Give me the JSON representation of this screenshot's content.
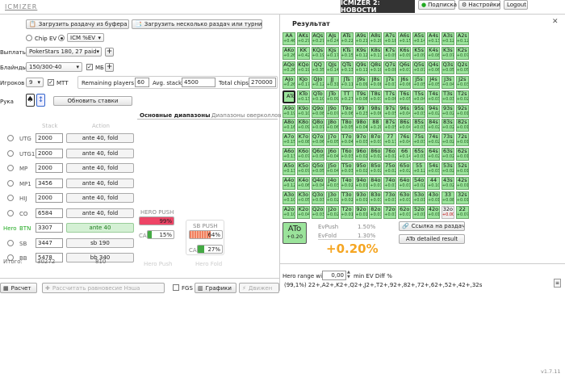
{
  "app": {
    "title": "ICMIZER",
    "version": "v1.7.11"
  },
  "banner": {
    "text": "ICMIZER 2: НОВОСТИ"
  },
  "top_buttons": {
    "subscribe": "Подписка",
    "settings": "Настройки",
    "logout": "Logout"
  },
  "toolbar": {
    "load_from_buffer": "Загрузить раздачу из буфера",
    "load_multiple": "Загрузить несколько раздач или турнир"
  },
  "model": {
    "chip_ev": "Chip EV",
    "icm_select": "ICM %EV"
  },
  "payouts": {
    "label": "Выплаты",
    "value": "PokerStars 180, 27 paid"
  },
  "blinds": {
    "label": "Блайнды",
    "value": "150/300-40",
    "mb_label": "МБ",
    "mb_checked": "✓"
  },
  "players": {
    "label": "Игроков",
    "value": "9",
    "mtt_label": "MTT",
    "mtt_checked": "✓",
    "remaining_label": "Remaining players",
    "remaining_value": "60",
    "avg_stack_label": "Avg. stack",
    "avg_stack_value": "4500",
    "total_chips_label": "Total chips",
    "total_chips_value": "270000"
  },
  "hand": {
    "label": "Рука",
    "update_button": "Обновить ставки"
  },
  "ranges_tabs": {
    "main": "Основные диапазоны",
    "overcall": "Диапазоны оверколлов"
  },
  "columns": {
    "stack": "Stack",
    "action": "Action"
  },
  "positions": [
    {
      "name": "UTG",
      "stack": "2000",
      "action": "ante 40, fold"
    },
    {
      "name": "UTG1",
      "stack": "2000",
      "action": "ante 40, fold"
    },
    {
      "name": "MP",
      "stack": "2000",
      "action": "ante 40, fold"
    },
    {
      "name": "MP1",
      "stack": "3456",
      "action": "ante 40, fold"
    },
    {
      "name": "HIJ",
      "stack": "2000",
      "action": "ante 40, fold"
    },
    {
      "name": "CO",
      "stack": "6584",
      "action": "ante 40, fold"
    },
    {
      "name": "BTN",
      "hero": "Hero",
      "stack": "3307",
      "action": "ante 40"
    },
    {
      "name": "SB",
      "stack": "3447",
      "action": "sb 190"
    },
    {
      "name": "BB",
      "stack": "5478",
      "action": "bb 340"
    }
  ],
  "totals": {
    "label": "Итого:",
    "stack": "30272",
    "action": "810"
  },
  "hero_push": {
    "title": "HERO PUSH",
    "value_pct": 99,
    "value": "99%",
    "ca_label": "CA",
    "ca_value": "15%",
    "ca_pct": 15,
    "caption": "Hero Push"
  },
  "sb_push": {
    "title": "SB PUSH",
    "value_pct": 64,
    "value": "64%",
    "ca_label": "CA",
    "ca_value": "27%",
    "ca_pct": 27,
    "caption": "Hero Fold"
  },
  "actions": {
    "calculate": "Расчет",
    "nash": "Рассчитать равновесие Нэша",
    "fgs": "FGS",
    "charts": "Графики",
    "movement": "Движен"
  },
  "result": {
    "title": "Результат",
    "grid": [
      [
        "AA|+0.46",
        "AKs|+0.27",
        "AQs|+0.27",
        "AJs|+0.24",
        "ATs|+0.22",
        "A9s|+0.21",
        "A8s|+0.20",
        "A7s|+0.18",
        "A6s|+0.15",
        "A5s|+0.14",
        "A4s|+0.13",
        "A3s|+0.12",
        "A2s|+0.12"
      ],
      [
        "AKo|+0.26",
        "KK|+0.42",
        "KQs|+0.19",
        "KJs|+0.17",
        "KTs|+0.15",
        "K9s|+0.12",
        "K8s|+0.11",
        "K7s|+0.09",
        "K6s|+0.09",
        "K5s|+0.09",
        "K4s|+0.08",
        "K3s|+0.07",
        "K2s|+0.07"
      ],
      [
        "AQo|+0.26",
        "KQo|+0.19",
        "QQ|+0.35",
        "QJs|+0.14",
        "QTs|+0.13",
        "Q9s|+0.11",
        "Q8s|+0.10",
        "Q7s|+0.08",
        "Q6s|+0.07",
        "Q5s|+0.07",
        "Q4s|+0.06",
        "Q3s|+0.05",
        "Q2s|+0.05"
      ],
      [
        "AJo|+0.26",
        "KJo|+0.17",
        "QJo|+0.12",
        "JJ|+0.31",
        "JTs|+0.11",
        "J9s|+0.09",
        "J8s|+0.08",
        "J7s|+0.07",
        "J6s|+0.06",
        "J5s|+0.05",
        "J4s|+0.05",
        "J3s|+0.04",
        "J2s|+0.03"
      ],
      [
        "ATo|+0.20",
        "KTo|+0.13",
        "QTo|+0.10",
        "JTo|+0.09",
        "TT|+0.27",
        "T9s|+0.08",
        "T8s|+0.07",
        "T7s|+0.06",
        "T6s|+0.05",
        "T5s|+0.04",
        "T4s|+0.03",
        "T3s|+0.03",
        "T2s|+0.02"
      ],
      [
        "A9o|+0.19",
        "K9o|+0.10",
        "Q9o|+0.08",
        "J9o|+0.07",
        "T9o|+0.06",
        "99|+0.23",
        "98s|+0.06",
        "97s|+0.05",
        "96s|+0.04",
        "95s|+0.03",
        "94s|+0.02",
        "93s|+0.02",
        "92s|+0.01"
      ],
      [
        "A8o|+0.16",
        "K8o|+0.09",
        "Q8o|+0.07",
        "J8o|+0.06",
        "T8o|+0.05",
        "98o|+0.04",
        "88|+0.20",
        "87s|+0.05",
        "86s|+0.04",
        "85s|+0.03",
        "84s|+0.02",
        "83s|+0.02",
        "82s|+0.01"
      ],
      [
        "A7o|+0.15",
        "K7o|+0.08",
        "Q7o|+0.06",
        "J7o|+0.05",
        "T7o|+0.04",
        "97o|+0.03",
        "87o|+0.03",
        "77|+0.17",
        "76s|+0.04",
        "75s|+0.03",
        "74s|+0.02",
        "73s|+0.02",
        "72s|+0.01"
      ],
      [
        "A6o|+0.13",
        "K6o|+0.07",
        "Q6o|+0.05",
        "J6o|+0.04",
        "T6o|+0.03",
        "96o|+0.02",
        "86o|+0.02",
        "76o|+0.02",
        "66|+0.14",
        "65s|+0.03",
        "64s|+0.02",
        "63s|+0.02",
        "62s|+0.01"
      ],
      [
        "A5o|+0.13",
        "K5o|+0.07",
        "Q5o|+0.05",
        "J5o|+0.04",
        "T5o|+0.03",
        "95o|+0.02",
        "85o|+0.02",
        "75o|+0.02",
        "65o|+0.02",
        "55|+0.12",
        "54s|+0.03",
        "53s|+0.02",
        "52s|+0.01"
      ],
      [
        "A4o|+0.12",
        "K4o|+0.06",
        "Q4o|+0.04",
        "J4o|+0.03",
        "T4o|+0.02",
        "94o|+0.01",
        "84o|+0.01",
        "74o|+0.01",
        "64o|+0.01",
        "54o|+0.02",
        "44|+0.10",
        "43s|+0.02",
        "42s|+0.01"
      ],
      [
        "A3o|+0.10",
        "K3o|+0.05",
        "Q3o|+0.03",
        "J3o|+0.02",
        "T3o|+0.02",
        "93o|+0.01",
        "83o|+0.01",
        "73o|+0.01",
        "63o|+0.01",
        "53o|+0.01",
        "43o|+0.01",
        "33|+0.08",
        "32s|+0.01"
      ],
      [
        "A2o|+0.10",
        "K2o|+0.04",
        "Q2o|+0.03",
        "J2o|+0.02",
        "T2o|+0.01",
        "92o|+0.01",
        "82o|+0.01",
        "72o|+0.01",
        "62o|+0.01",
        "52o|+0.01",
        "42o|+0.01",
        "32o|+0.00",
        "22|+0.07"
      ]
    ],
    "selected_hand": "ATo",
    "selected_ev": "+0.20",
    "evpush_label": "EvPush",
    "evpush_value": "1.50%",
    "evfold_label": "EvFold",
    "evfold_value": "1.30%",
    "diff": "+0.20%",
    "share_link": "Ссылка на раздачу",
    "detailed": "ATo detailed result",
    "hero_range_label": "Hero range with",
    "hero_range_value": "0,00",
    "hero_range_suffix": "min EV Diff %",
    "range_text": "(99,1%) 22+,A2+,K2+,Q2+,J2+,T2+,92+,82+,72+,62+,52+,42+,32s"
  },
  "colors": {
    "positive": "#9be39b",
    "neutral": "#eeeeee",
    "push": "#ee4466",
    "diff": "#f5a623"
  }
}
